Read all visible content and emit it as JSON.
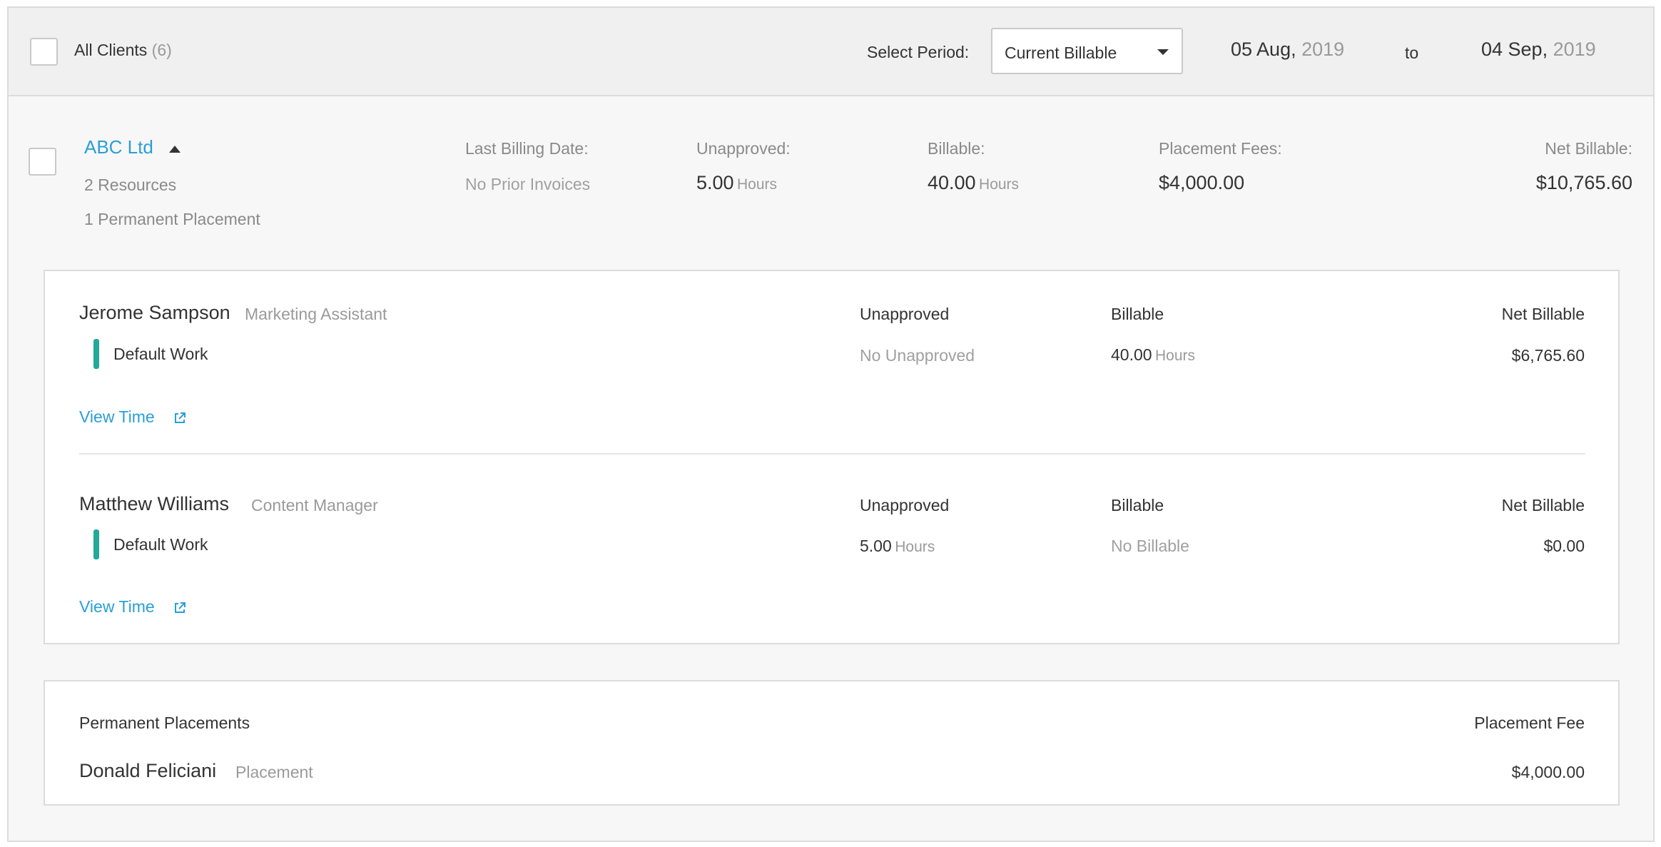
{
  "header": {
    "all_clients_label": "All Clients",
    "all_clients_count": "(6)",
    "select_period_label": "Select Period:",
    "period_value": "Current Billable",
    "from_date": "05 Aug,",
    "from_year": "2019",
    "to_label": "to",
    "to_date": "04 Sep,",
    "to_year": "2019"
  },
  "client": {
    "name": "ABC Ltd",
    "resources": "2 Resources",
    "placements": "1 Permanent Placement",
    "last_billing_label": "Last Billing Date:",
    "last_billing_value": "No Prior Invoices",
    "unapproved_label": "Unapproved:",
    "unapproved_value": "5.00",
    "unapproved_unit": "Hours",
    "billable_label": "Billable:",
    "billable_value": "40.00",
    "billable_unit": "Hours",
    "placement_fees_label": "Placement Fees:",
    "placement_fees_value": "$4,000.00",
    "net_billable_label": "Net Billable:",
    "net_billable_value": "$10,765.60"
  },
  "resources": [
    {
      "name": "Jerome Sampson",
      "role": "Marketing Assistant",
      "work": "Default Work",
      "unapproved_head": "Unapproved",
      "billable_head": "Billable",
      "net_head": "Net Billable",
      "unapproved": "No Unapproved",
      "billable": "40.00",
      "billable_unit": "Hours",
      "net": "$6,765.60",
      "view_time": "View Time"
    },
    {
      "name": "Matthew Williams",
      "role": "Content Manager",
      "work": "Default Work",
      "unapproved_head": "Unapproved",
      "billable_head": "Billable",
      "net_head": "Net Billable",
      "unapproved": "5.00",
      "unapproved_unit": "Hours",
      "billable": "No Billable",
      "net": "$0.00",
      "view_time": "View Time"
    }
  ],
  "permanent": {
    "title": "Permanent Placements",
    "fee_head": "Placement Fee",
    "name": "Donald Feliciani",
    "type": "Placement",
    "fee": "$4,000.00"
  },
  "icons": {
    "external_link": "external-link-icon",
    "caret_up": "caret-up-icon",
    "caret_down": "chevron-down-icon"
  },
  "colors": {
    "accent_link": "#2a9fd6",
    "work_bar": "#24a89a"
  }
}
